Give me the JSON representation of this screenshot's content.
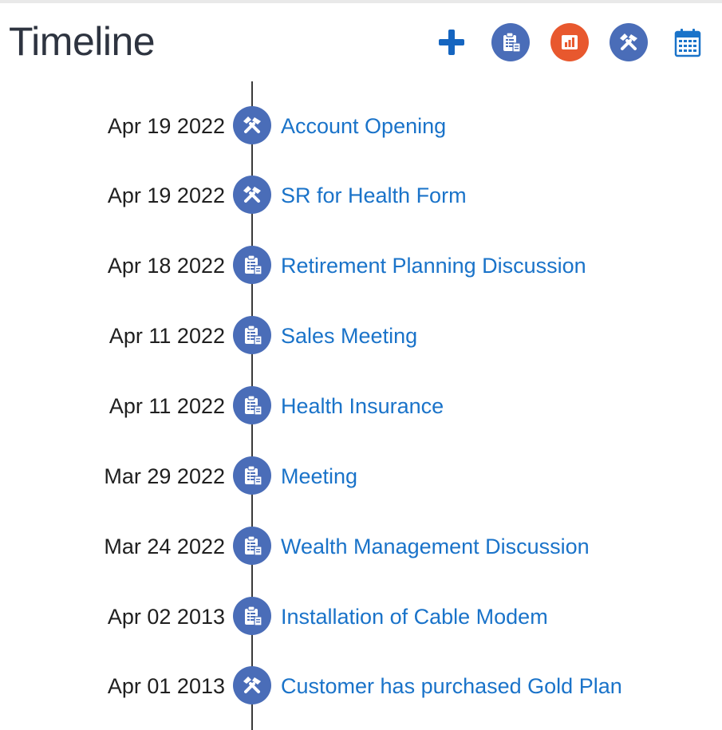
{
  "header": {
    "title": "Timeline"
  },
  "toolbar": {
    "items": [
      {
        "icon": "plus-icon"
      },
      {
        "icon": "task-clipboard-icon"
      },
      {
        "icon": "chart-icon"
      },
      {
        "icon": "tools-icon"
      },
      {
        "icon": "calendar-icon"
      }
    ]
  },
  "colors": {
    "node_blue": "#4a6db8",
    "accent_orange": "#e8582e",
    "link_blue": "#1a73c9",
    "plus_blue": "#1565c0"
  },
  "events": [
    {
      "date": "Apr 19 2022",
      "title": "Account Opening",
      "icon": "tools-icon"
    },
    {
      "date": "Apr 19 2022",
      "title": "SR for Health Form",
      "icon": "tools-icon"
    },
    {
      "date": "Apr 18 2022",
      "title": "Retirement Planning Discussion",
      "icon": "task-clipboard-icon"
    },
    {
      "date": "Apr 11 2022",
      "title": "Sales Meeting",
      "icon": "task-clipboard-icon"
    },
    {
      "date": "Apr 11 2022",
      "title": "Health Insurance",
      "icon": "task-clipboard-icon"
    },
    {
      "date": "Mar 29 2022",
      "title": "Meeting",
      "icon": "task-clipboard-icon"
    },
    {
      "date": "Mar 24 2022",
      "title": "Wealth Management Discussion",
      "icon": "task-clipboard-icon"
    },
    {
      "date": "Apr 02 2013",
      "title": "Installation of Cable Modem",
      "icon": "task-clipboard-icon"
    },
    {
      "date": "Apr 01 2013",
      "title": "Customer has purchased Gold Plan",
      "icon": "tools-icon"
    }
  ]
}
